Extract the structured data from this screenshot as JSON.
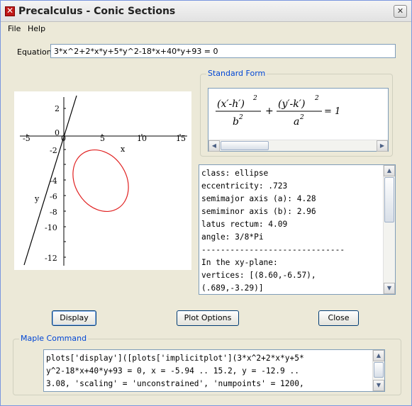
{
  "window": {
    "title": "Precalculus - Conic Sections",
    "close_glyph": "✕"
  },
  "menu": {
    "items": [
      "File",
      "Help"
    ]
  },
  "equation": {
    "label": "Equation:",
    "value": "3*x^2+2*x*y+5*y^2-18*x+40*y+93 = 0"
  },
  "plot": {
    "x_label": "x",
    "y_label": "y",
    "x_ticks": [
      "-5",
      "0",
      "5",
      "10",
      "15"
    ],
    "y_ticks": [
      "2",
      "0",
      "-2",
      "-4",
      "-6",
      "-8",
      "-10",
      "-12"
    ],
    "ellipse_color": "#e02020",
    "line_color": "#000000"
  },
  "standard_form": {
    "legend": "Standard Form",
    "num1": "(x′‑h′)",
    "den1": "b",
    "num2": "(y′‑k′)",
    "den2": "a",
    "exp": "2",
    "plus": "+",
    "rhs": "= 1"
  },
  "info": {
    "lines": [
      "class: ellipse",
      "eccentricity: .723",
      "semimajor axis (a): 4.28",
      "semiminor axis (b): 2.96",
      "latus rectum: 4.09",
      "angle: 3/8*Pi",
      "------------------------------",
      "In the xy-plane:",
      "vertices: [(8.60,-6.57),",
      "(.689,-3.29)]"
    ]
  },
  "buttons": {
    "display": "Display",
    "plot_options": "Plot Options",
    "close": "Close"
  },
  "maple": {
    "legend": "Maple Command",
    "lines": [
      "plots['display']([plots['implicitplot'](3*x^2+2*x*y+5*",
      "y^2-18*x+40*y+93 = 0, x = -5.94 .. 15.2, y = -12.9 ..",
      "3.08, 'scaling' = 'unconstrained', 'numpoints' = 1200,"
    ]
  }
}
